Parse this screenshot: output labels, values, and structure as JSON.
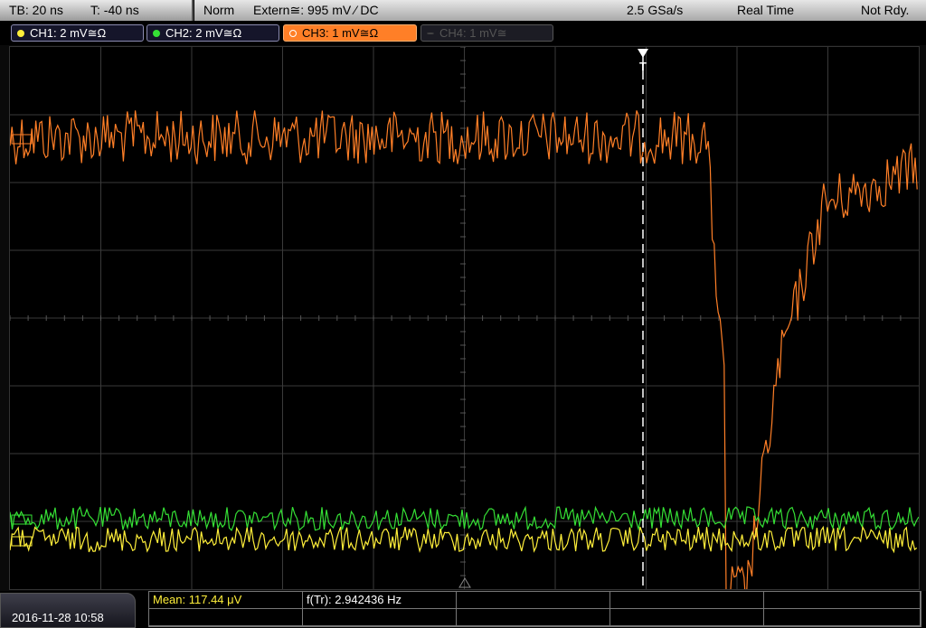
{
  "header": {
    "timebase": "TB: 20 ns",
    "trigger_pos": "T: -40 ns",
    "mode": "Norm",
    "trigger_source": "Extern≅: 995 mV ⁄ DC",
    "sample_rate": "2.5 GSa/s",
    "acq_mode": "Real Time",
    "state": "Not Rdy."
  },
  "channels": [
    {
      "label": "CH1: 2 mV≅Ω",
      "color": "#ffef3a",
      "state": "on"
    },
    {
      "label": "CH2: 2 mV≅Ω",
      "color": "#35e035",
      "state": "on"
    },
    {
      "label": "CH3: 1 mV≅Ω",
      "color": "#ff7f27",
      "state": "selected"
    },
    {
      "label": "CH4: 1 mV≅",
      "color": "#555555",
      "state": "off"
    }
  ],
  "footer": {
    "datetime": "2016-11-28 10:58",
    "mean": "Mean: 117.44 μV",
    "freq": "f(Tr): 2.942436 Hz"
  },
  "colors": {
    "ch1": "#ffef3a",
    "ch2": "#35e035",
    "ch3": "#ff7f27",
    "grid": "#3a3a3a"
  },
  "trigger_marker": "T"
}
